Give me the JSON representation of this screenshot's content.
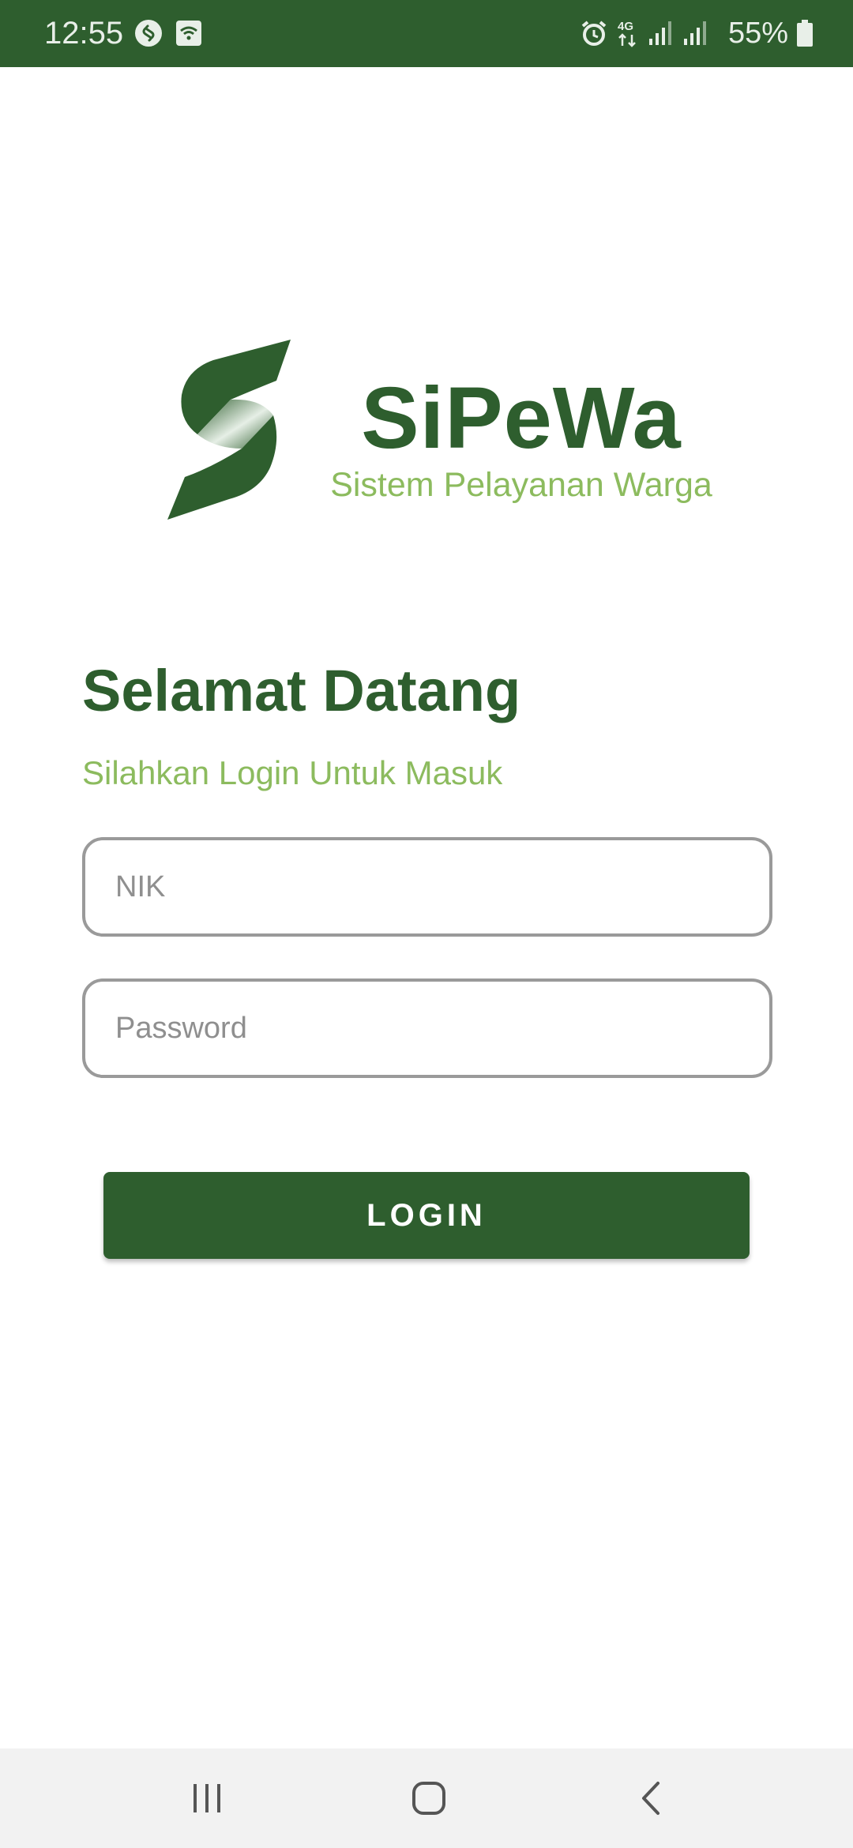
{
  "status_bar": {
    "time": "12:55",
    "left_icons": [
      "shazam-icon",
      "wifi-hotspot-icon"
    ],
    "right_icons": [
      "alarm-icon",
      "network-4g-icon",
      "signal-icon",
      "signal-icon"
    ],
    "battery_text": "55%"
  },
  "brand": {
    "title": "SiPeWa",
    "subtitle": "Sistem Pelayanan Warga"
  },
  "welcome": {
    "title": "Selamat Datang",
    "subtitle": "Silahkan Login Untuk Masuk"
  },
  "form": {
    "nik_placeholder": "NIK",
    "nik_value": "",
    "password_placeholder": "Password",
    "password_value": "",
    "login_label": "LOGIN"
  },
  "nav_bar": {
    "icons": [
      "recents-icon",
      "home-icon",
      "back-icon"
    ]
  },
  "colors": {
    "primary": "#2e5e2e",
    "accent": "#8cbb5e",
    "field_border": "#9a9a9a",
    "nav_background": "#f2f2f2"
  }
}
